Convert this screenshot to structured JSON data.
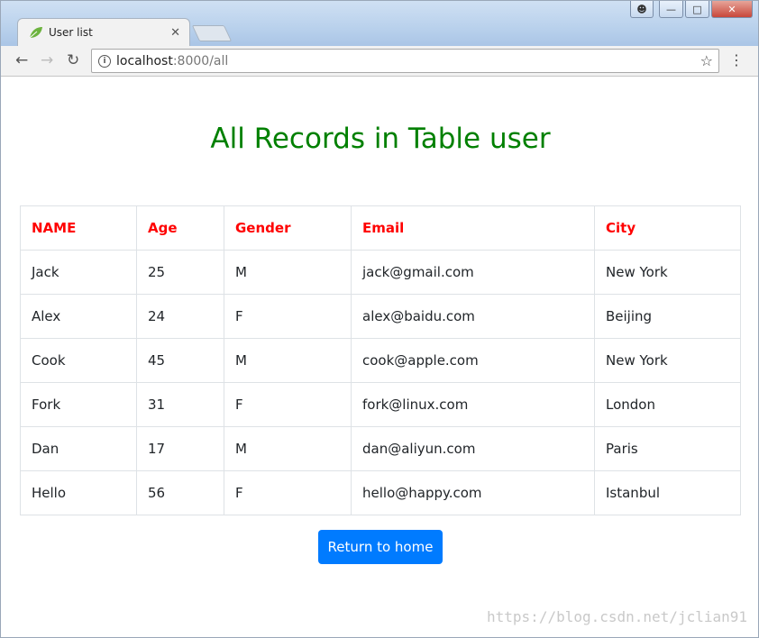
{
  "browser": {
    "tab_title": "User list",
    "url_host": "localhost",
    "url_path": ":8000/all"
  },
  "page": {
    "title": "All Records in Table user",
    "table": {
      "headers": [
        "NAME",
        "Age",
        "Gender",
        "Email",
        "City"
      ],
      "rows": [
        [
          "Jack",
          "25",
          "M",
          "jack@gmail.com",
          "New York"
        ],
        [
          "Alex",
          "24",
          "F",
          "alex@baidu.com",
          "Beijing"
        ],
        [
          "Cook",
          "45",
          "M",
          "cook@apple.com",
          "New York"
        ],
        [
          "Fork",
          "31",
          "F",
          "fork@linux.com",
          "London"
        ],
        [
          "Dan",
          "17",
          "M",
          "dan@aliyun.com",
          "Paris"
        ],
        [
          "Hello",
          "56",
          "F",
          "hello@happy.com",
          "Istanbul"
        ]
      ]
    },
    "return_button": "Return to home"
  },
  "watermark": "https://blog.csdn.net/jclian91",
  "colors": {
    "title": "#008000",
    "header_text": "#ff0000",
    "button": "#007bff"
  },
  "icons": {
    "back": "back-arrow-icon",
    "forward": "forward-arrow-icon",
    "reload": "reload-icon",
    "info": "info-icon",
    "star": "star-icon",
    "menu": "kebab-menu-icon"
  }
}
